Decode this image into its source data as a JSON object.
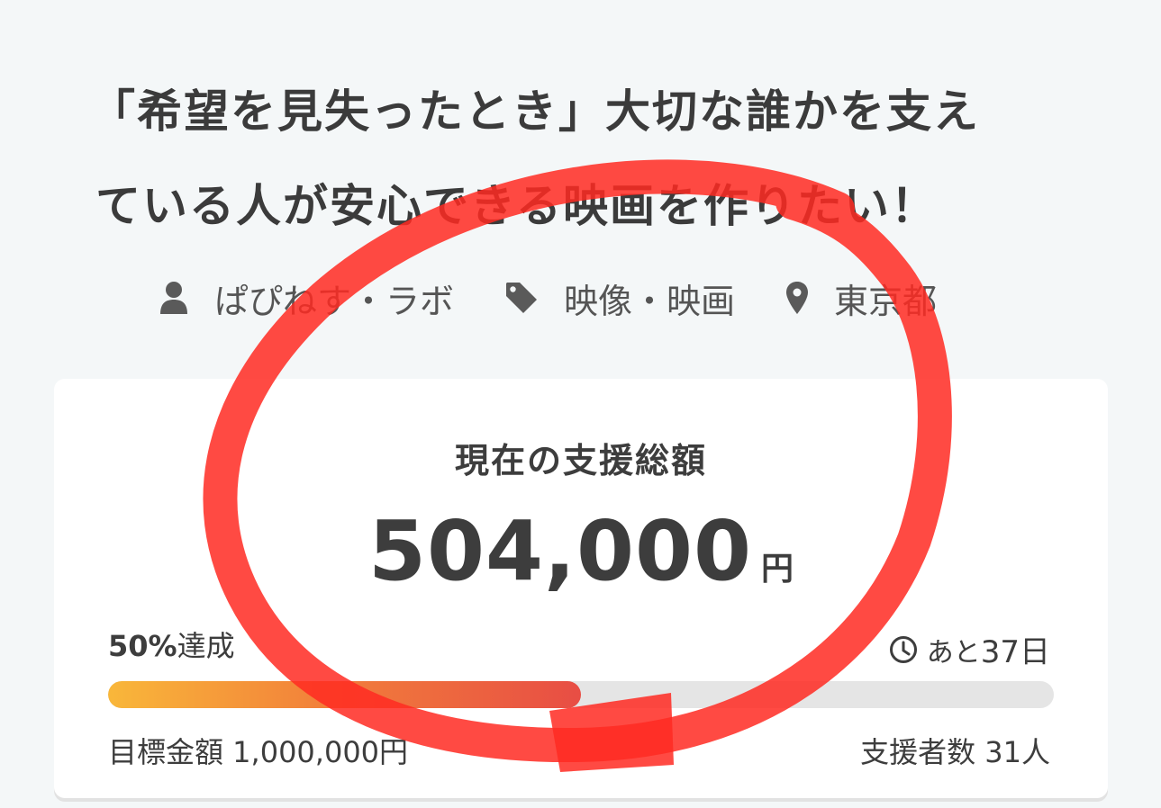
{
  "project": {
    "title_line1": "「希望を見失ったとき」大切な誰かを支え",
    "title_line2": "ている人が安心できる映画を作りたい！"
  },
  "meta": {
    "owner": {
      "icon": "user-icon",
      "label": "ぱぴねす・ラボ"
    },
    "category": {
      "icon": "tag-icon",
      "label": "映像・映画"
    },
    "location": {
      "icon": "location-pin-icon",
      "label": "東京都"
    }
  },
  "funding": {
    "current_label": "現在の支援総額",
    "current_amount": "504,000",
    "currency": "円",
    "achieved_percent": "50%",
    "achieved_suffix": "達成",
    "progress_fraction": 0.5,
    "remaining_icon": "clock-icon",
    "remaining_prefix": "あと",
    "remaining_days": "37日",
    "goal_text": "目標金額 1,000,000円",
    "supporters_text": "支援者数 31人"
  },
  "colors": {
    "background": "#f4f7f8",
    "card": "#ffffff",
    "text": "#3d3d3d",
    "progress_start": "#f9b73a",
    "progress_end": "#e84d44",
    "progress_track": "#e5e5e5",
    "annotation": "#ff2a22"
  }
}
